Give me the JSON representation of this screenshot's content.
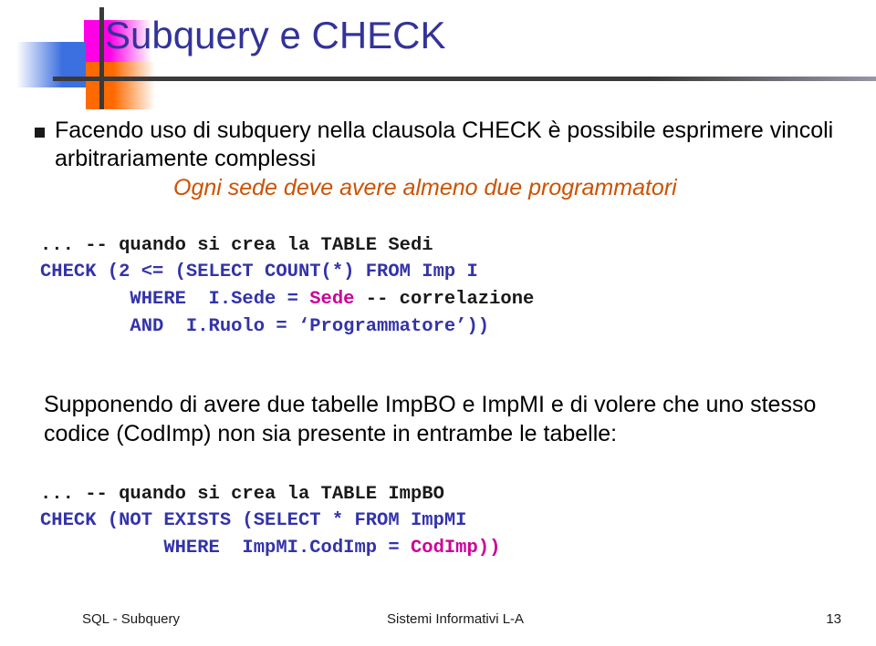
{
  "slide": {
    "title": "Subquery e CHECK",
    "bullet1": "Facendo uso di subquery nella clausola CHECK è possibile esprimere vincoli arbitrariamente complessi",
    "subitem1": "Ogni sede deve avere almeno due programmatori",
    "code1": {
      "line1": "... -- quando si crea la TABLE Sedi",
      "line2": "CHECK (2 <= (SELECT COUNT(*) FROM Imp I",
      "line3_prefix": "        WHERE  I.Sede = ",
      "line3_highlight": "Sede",
      "line3_comment": " -- correlazione",
      "line4": "        AND  I.Ruolo = ‘Programmatore’))"
    },
    "paragraph": "Supponendo di avere due tabelle ImpBO e ImpMI e di volere che uno stesso codice (CodImp) non sia presente in entrambe le tabelle:",
    "code2": {
      "line1": "... -- quando si crea la TABLE ImpBO",
      "line2": "CHECK (NOT EXISTS (SELECT * FROM ImpMI",
      "line3_prefix": "           WHERE  ImpMI.CodImp = ",
      "line3_highlight": "CodImp))"
    }
  },
  "footer": {
    "left": "SQL - Subquery",
    "center": "Sistemi Informativi L-A",
    "page": "13"
  },
  "colors": {
    "title": "#333399",
    "code_keyword": "#3333aa",
    "code_highlight": "#cc0099",
    "subitem": "#cc5200",
    "logo_magenta": "#ff00e6",
    "logo_blue": "#3c6fe0",
    "logo_orange": "#ff6a00"
  }
}
